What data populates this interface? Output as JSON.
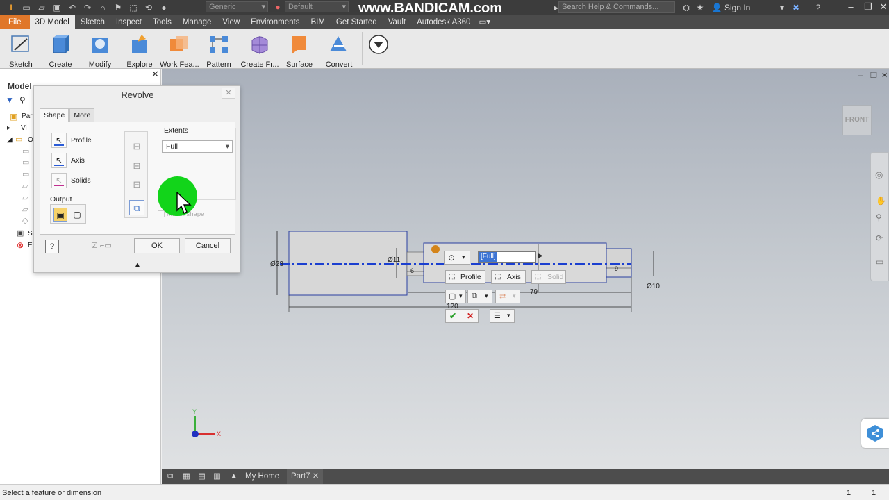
{
  "titlebar": {
    "material_combo": "Generic",
    "appearance_combo": "Default",
    "watermark": "www.BANDICAM.com",
    "search_placeholder": "Search Help & Commands...",
    "sign_in": "Sign In"
  },
  "ribbon_tabs": [
    "File",
    "3D Model",
    "Sketch",
    "Inspect",
    "Tools",
    "Manage",
    "View",
    "Environments",
    "BIM",
    "Get Started",
    "Vault",
    "Autodesk A360"
  ],
  "ribbon_active_tab": "3D Model",
  "ribbon_buttons": [
    "Sketch",
    "Create",
    "Modify",
    "Explore",
    "Work Fea...",
    "Pattern",
    "Create Fr...",
    "Surface",
    "Convert"
  ],
  "browser": {
    "title": "Model",
    "tree_prefixes": [
      "Par",
      "Vi",
      "O",
      "Sl",
      "Er"
    ]
  },
  "revolve": {
    "title": "Revolve",
    "tabs": [
      "Shape",
      "More"
    ],
    "profile_label": "Profile",
    "axis_label": "Axis",
    "solids_label": "Solids",
    "output_label": "Output",
    "extents_label": "Extents",
    "extents_value": "Full",
    "match_shape_label": "Match shape",
    "ok_label": "OK",
    "cancel_label": "Cancel"
  },
  "viewport": {
    "viewcube_label": "FRONT",
    "dimensions": {
      "d23": "Ø23",
      "d11": "Ø11",
      "d6": "6",
      "d9": "9",
      "d10": "Ø10",
      "d79": "79",
      "d120": "120"
    },
    "mini_toolbar": {
      "value": "[Full]",
      "profile": "Profile",
      "axis": "Axis",
      "solid": "Solid"
    }
  },
  "doc_tabs": {
    "home": "My Home",
    "part": "Part7"
  },
  "status": {
    "text": "Select a feature or dimension",
    "num1": "1",
    "num2": "1"
  },
  "colors": {
    "file_tab": "#e0772a",
    "axis_line": "#1b3fd0",
    "click_highlight": "#12d41a",
    "selection": "#3d74d4"
  }
}
